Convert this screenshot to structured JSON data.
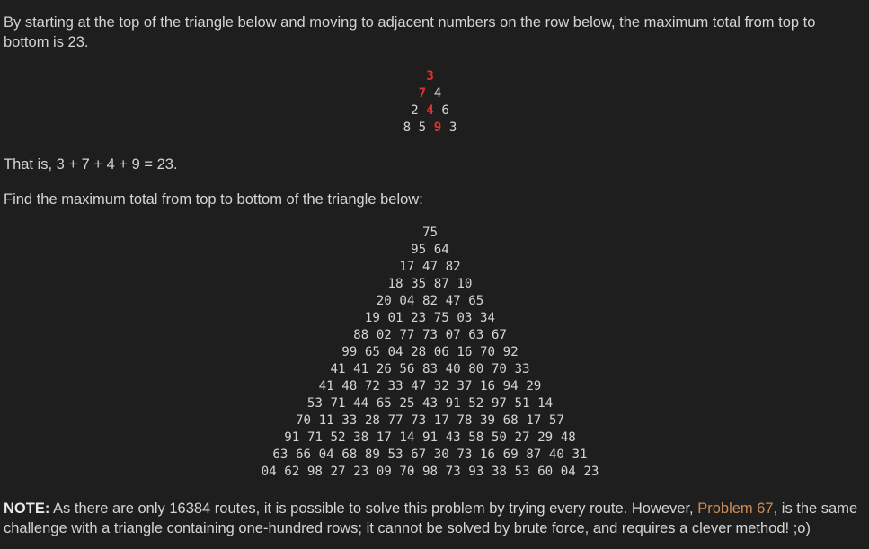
{
  "intro": "By starting at the top of the triangle below and moving to adjacent numbers on the row below, the maximum total from top to bottom is 23.",
  "small_triangle": [
    [
      {
        "v": "3",
        "hl": true
      }
    ],
    [
      {
        "v": "7",
        "hl": true
      },
      {
        "v": "4",
        "hl": false
      }
    ],
    [
      {
        "v": "2",
        "hl": false
      },
      {
        "v": "4",
        "hl": true
      },
      {
        "v": "6",
        "hl": false
      }
    ],
    [
      {
        "v": "8",
        "hl": false
      },
      {
        "v": "5",
        "hl": false
      },
      {
        "v": "9",
        "hl": true
      },
      {
        "v": "3",
        "hl": false
      }
    ]
  ],
  "that_is": "That is, 3 + 7 + 4 + 9 = 23.",
  "find_text": "Find the maximum total from top to bottom of the triangle below:",
  "big_triangle": [
    "75",
    "95 64",
    "17 47 82",
    "18 35 87 10",
    "20 04 82 47 65",
    "19 01 23 75 03 34",
    "88 02 77 73 07 63 67",
    "99 65 04 28 06 16 70 92",
    "41 41 26 56 83 40 80 70 33",
    "41 48 72 33 47 32 37 16 94 29",
    "53 71 44 65 25 43 91 52 97 51 14",
    "70 11 33 28 77 73 17 78 39 68 17 57",
    "91 71 52 38 17 14 91 43 58 50 27 29 48",
    "63 66 04 68 89 53 67 30 73 16 69 87 40 31",
    "04 62 98 27 23 09 70 98 73 93 38 53 60 04 23"
  ],
  "note": {
    "label": "NOTE:",
    "text_before": " As there are only 16384 routes, it is possible to solve this problem by trying every route. However, ",
    "link_text": "Problem 67",
    "text_after": ", is the same challenge with a triangle containing one-hundred rows; it cannot be solved by brute force, and requires a clever method! ;o)"
  },
  "colors": {
    "background": "#1e1e1e",
    "text": "#d4d4d4",
    "highlight": "#e03131",
    "link": "#c98e5a"
  }
}
